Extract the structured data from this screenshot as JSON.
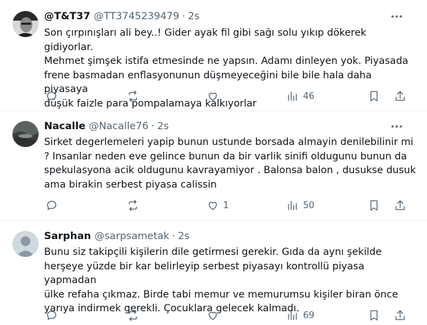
{
  "tweets": [
    {
      "name": "@T&T37",
      "handle": "@TT3745239479",
      "separator": "·",
      "time": "2s",
      "text": "Son çırpınışları ali bey..! Gider ayak fil gibi sağı solu yıkıp dökerek gidiyorlar.\nMehmet şimşek istifa etmesinde ne yapsın. Adamı dinleyen yok. Piyasada\nfrene basmadan enflasyonunun düşmeyeceğini bile bile hala daha piyasaya\ndüşük faizle para pompalamaya kalkıyorlar",
      "like_count": "",
      "views_count": "46",
      "avatar": "portrait-photo"
    },
    {
      "name": "Nacalle",
      "handle": "@Nacalle76",
      "separator": "·",
      "time": "2s",
      "text": "Sirket degerlemeleri yapip bunun ustunde borsada almayin denilebilinir mi\n? Insanlar neden eve gelince bunun da bir varlik sinifi oldugunu bunun da\nspekulasyona acik oldugunu kavrayamiyor . Balonsa balon , dusukse dusuk\nama birakin serbest piyasa calissin",
      "like_count": "1",
      "views_count": "50",
      "avatar": "landscape-photo"
    },
    {
      "name": "Sarphan",
      "handle": "@sarpsametak",
      "separator": "·",
      "time": "2s",
      "text": "Bunu siz takipçili kişilerin dile getirmesi gerekir. Gıda da aynı şekilde\nherşeye yüzde bir kar belirleyip serbest piyasayı kontrollü piyasa yapmadan\nülke refaha çıkmaz.  Birde tabi memur ve memurumsu kişiler biran önce\nyarıya indirmek gerekli. Çocuklara gelecek kalmadı.",
      "like_count": "",
      "views_count": "69",
      "avatar": "default-avatar"
    }
  ],
  "colors": {
    "text": "#0f1419",
    "secondary": "#536471",
    "divider": "#eff3f4"
  }
}
